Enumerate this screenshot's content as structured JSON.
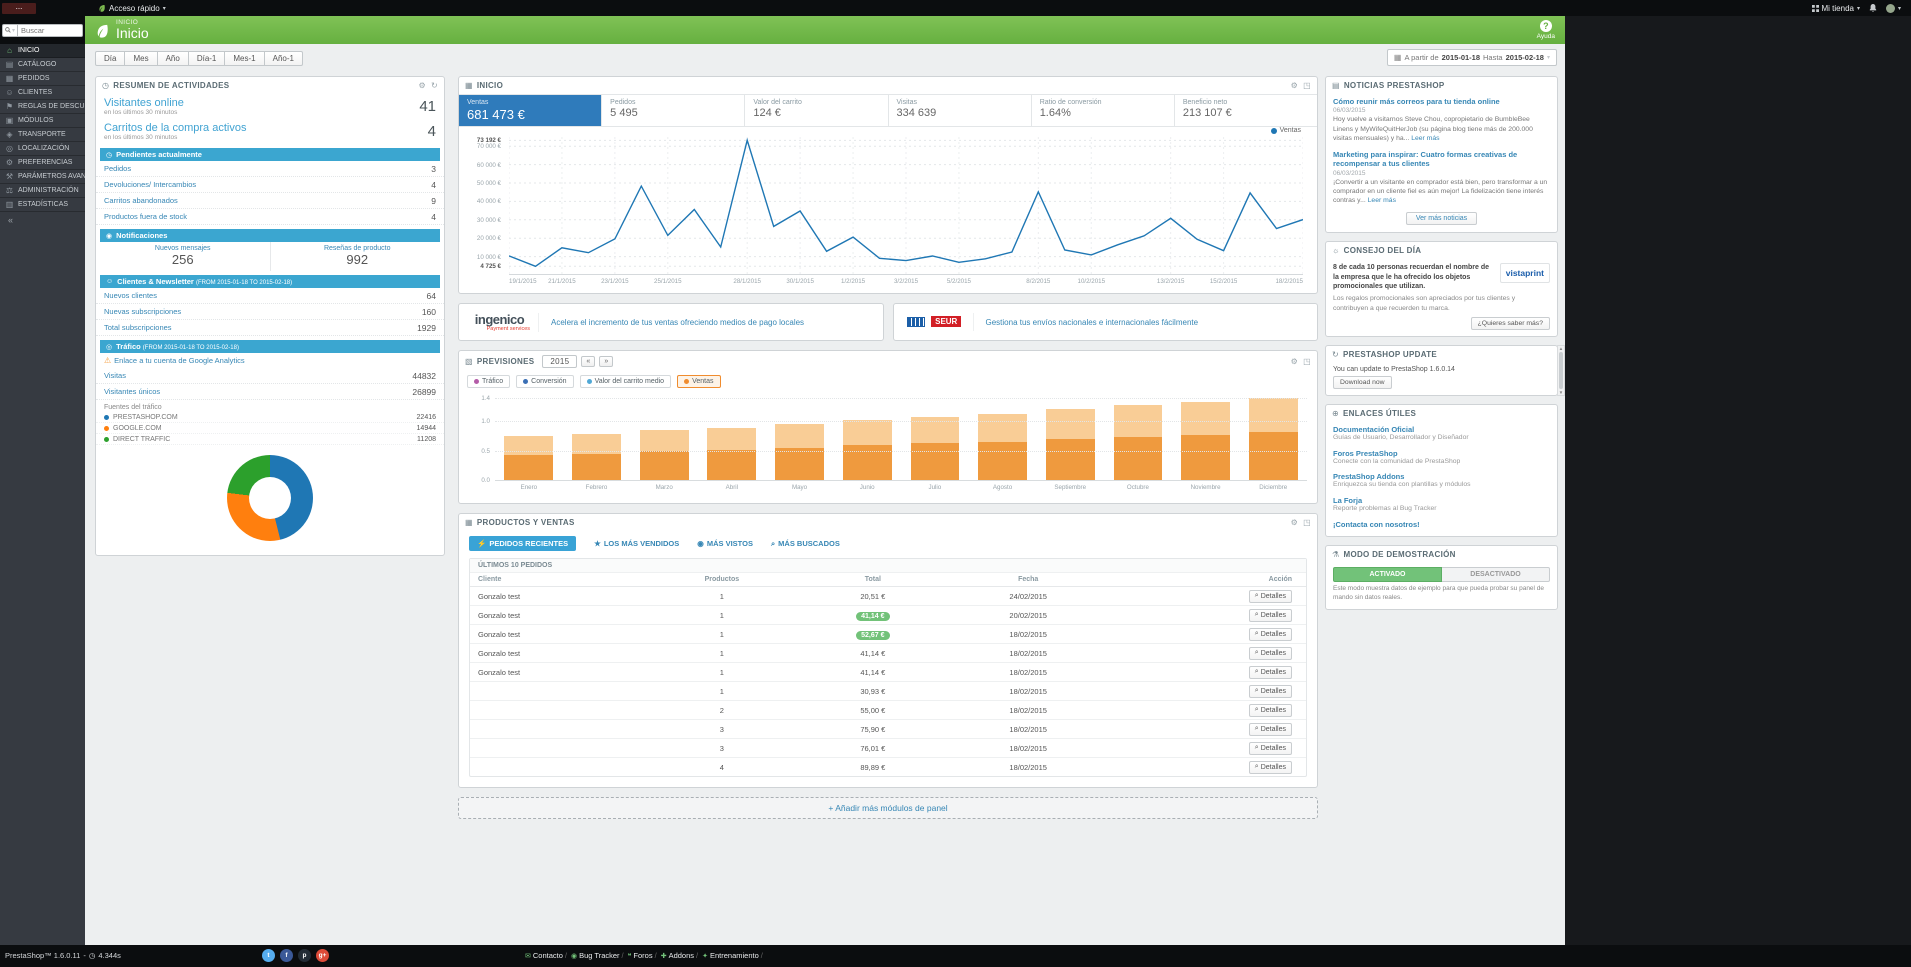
{
  "icons": {
    "gear": "⚙",
    "refresh": "↻",
    "expand": "◳",
    "caret_down": "▾",
    "clock": "◷",
    "calendar": "▦",
    "warning": "⚠",
    "bulb": "☼",
    "news": "▤",
    "panel": "▦",
    "forecast": "▧",
    "link": "⊕",
    "flask": "⚗",
    "plus": "+",
    "help": "?",
    "prev": "«",
    "next": "»",
    "collapse": "«",
    "time": "◷",
    "up": "▲",
    "down": "▼"
  },
  "topbar": {
    "logo_text": "...",
    "quick_access": "Acceso rápido",
    "shop_name": "Mi tienda",
    "search_placeholder": "Buscar"
  },
  "header": {
    "breadcrumb": "INICIO",
    "title": "Inicio",
    "help_label": "Ayuda"
  },
  "sidebar": {
    "items": [
      {
        "icon": "⌂",
        "label": "INICIO",
        "active": true
      },
      {
        "icon": "▤",
        "label": "CATÁLOGO"
      },
      {
        "icon": "▦",
        "label": "PEDIDOS"
      },
      {
        "icon": "☺",
        "label": "CLIENTES"
      },
      {
        "icon": "⚑",
        "label": "REGLAS DE DESCUENTOS"
      },
      {
        "icon": "▣",
        "label": "MÓDULOS"
      },
      {
        "icon": "◈",
        "label": "TRANSPORTE"
      },
      {
        "icon": "◎",
        "label": "LOCALIZACIÓN"
      },
      {
        "icon": "⚙",
        "label": "PREFERENCIAS"
      },
      {
        "icon": "⚒",
        "label": "PARÁMETROS AVANZADOS"
      },
      {
        "icon": "⚖",
        "label": "ADMINISTRACIÓN"
      },
      {
        "icon": "▥",
        "label": "ESTADÍSTICAS"
      }
    ]
  },
  "toolbar": {
    "range_buttons": [
      "Día",
      "Mes",
      "Año",
      "Día-1",
      "Mes-1",
      "Año-1"
    ],
    "from_label": "A partir de",
    "from_date": "2015-01-18",
    "to_label": "Hasta",
    "to_date": "2015-02-18"
  },
  "activity": {
    "title": "RESUMEN DE ACTIVIDADES",
    "online": {
      "label": "Visitantes online",
      "sub": "en los últimos 30 minutos",
      "value": "41"
    },
    "carts": {
      "label": "Carritos de la compra activos",
      "sub": "en los últimos 30 minutos",
      "value": "4"
    },
    "pending_title": "Pendientes actualmente",
    "pending_icon": "◷",
    "pending": [
      {
        "label": "Pedidos",
        "value": "3"
      },
      {
        "label": "Devoluciones/ Intercambios",
        "value": "4"
      },
      {
        "label": "Carritos abandonados",
        "value": "9"
      },
      {
        "label": "Productos fuera de stock",
        "value": "4"
      }
    ],
    "notifications_title": "Notificaciones",
    "notifications_icon": "◉",
    "notifications": [
      {
        "label": "Nuevos mensajes",
        "value": "256"
      },
      {
        "label": "Reseñas de producto",
        "value": "992"
      }
    ],
    "customers_title": "Clientes & Newsletter",
    "customers_icon": "☺",
    "customers_range": "(FROM 2015-01-18 TO 2015-02-18)",
    "customers": [
      {
        "label": "Nuevos clientes",
        "value": "64"
      },
      {
        "label": "Nuevas subscripciones",
        "value": "160"
      },
      {
        "label": "Total subscripciones",
        "value": "1929"
      }
    ],
    "traffic_title": "Tráfico",
    "traffic_icon": "◎",
    "traffic_range": "(FROM 2015-01-18 TO 2015-02-18)",
    "analytics_link": "Enlace a tu cuenta de Google Analytics",
    "traffic_rows": [
      {
        "label": "Visitas",
        "value": "44832"
      },
      {
        "label": "Visitantes únicos",
        "value": "26899"
      }
    ],
    "sources_label": "Fuentes del tráfico",
    "sources": [
      {
        "label": "PRESTASHOP.COM",
        "value": "22416",
        "color": "#1f77b4"
      },
      {
        "label": "GOOGLE.COM",
        "value": "14944",
        "color": "#ff7f0e"
      },
      {
        "label": "DIRECT TRAFFIC",
        "value": "11208",
        "color": "#2ca02c"
      }
    ]
  },
  "trends": {
    "title": "INICIO",
    "kpis": [
      {
        "label": "Ventas",
        "value": "681 473 €",
        "active": true
      },
      {
        "label": "Pedidos",
        "value": "5 495"
      },
      {
        "label": "Valor del carrito",
        "value": "124 €"
      },
      {
        "label": "Visitas",
        "value": "334 639"
      },
      {
        "label": "Ratio de conversión",
        "value": "1.64%"
      },
      {
        "label": "Beneficio neto",
        "value": "213 107 €"
      }
    ],
    "legend": "Ventas"
  },
  "banners": [
    {
      "brand": "ingenico",
      "brand_sub": "Payment services",
      "text": "Acelera el incremento de tus ventas ofreciendo medios de pago locales"
    },
    {
      "brand": "SEUR",
      "text": "Gestiona tus envíos nacionales e internacionales fácilmente"
    }
  ],
  "forecast_panel": {
    "title": "PREVISIONES",
    "year": "2015",
    "metrics": [
      {
        "label": "Tráfico",
        "color": "#B45CA8"
      },
      {
        "label": "Conversión",
        "color": "#3B6FB5"
      },
      {
        "label": "Valor del carrito medio",
        "color": "#50A8D6"
      },
      {
        "label": "Ventas",
        "color": "#F08C2E",
        "active": true
      }
    ]
  },
  "products": {
    "title": "PRODUCTOS Y VENTAS",
    "tabs": [
      {
        "icon": "⚡",
        "label": "PEDIDOS RECIENTES",
        "active": true
      },
      {
        "icon": "★",
        "label": "LOS MÁS VENDIDOS"
      },
      {
        "icon": "◉",
        "label": "MÁS VISTOS"
      },
      {
        "icon": "⌕",
        "label": "MÁS BUSCADOS"
      }
    ],
    "subtitle": "ÚLTIMOS 10 PEDIDOS",
    "headers": [
      "Cliente",
      "Productos",
      "Total",
      "Fecha",
      "Acción"
    ],
    "action_icon": "⌕",
    "action_label": "Detalles",
    "rows": [
      {
        "client": "Gonzalo test",
        "products": "1",
        "total": "20,51 €",
        "badge": false,
        "date": "24/02/2015"
      },
      {
        "client": "Gonzalo test",
        "products": "1",
        "total": "41,14 €",
        "badge": true,
        "date": "20/02/2015"
      },
      {
        "client": "Gonzalo test",
        "products": "1",
        "total": "52,67 €",
        "badge": true,
        "date": "18/02/2015"
      },
      {
        "client": "Gonzalo test",
        "products": "1",
        "total": "41,14 €",
        "badge": false,
        "date": "18/02/2015"
      },
      {
        "client": "Gonzalo test",
        "products": "1",
        "total": "41,14 €",
        "badge": false,
        "date": "18/02/2015"
      },
      {
        "client": "",
        "products": "1",
        "total": "30,93 €",
        "badge": false,
        "date": "18/02/2015"
      },
      {
        "client": "",
        "products": "2",
        "total": "55,00 €",
        "badge": false,
        "date": "18/02/2015"
      },
      {
        "client": "",
        "products": "3",
        "total": "75,90 €",
        "badge": false,
        "date": "18/02/2015"
      },
      {
        "client": "",
        "products": "3",
        "total": "76,01 €",
        "badge": false,
        "date": "18/02/2015"
      },
      {
        "client": "",
        "products": "4",
        "total": "89,89 €",
        "badge": false,
        "date": "18/02/2015"
      }
    ]
  },
  "add_module_label": "Añadir más módulos de panel",
  "news": {
    "title": "NOTICIAS PRESTASHOP",
    "items": [
      {
        "headline": "Cómo reunir más correos para tu tienda online",
        "date": "06/03/2015",
        "body": "Hoy vuelve a visitarnos Steve Chou, copropietario de BumbleBee Linens y MyWifeQuitHerJob (su página blog tiene más de 200.000 visitas mensuales) y ha...",
        "more": "Leer más"
      },
      {
        "headline": "Marketing para inspirar: Cuatro formas creativas de recompensar a tus clientes",
        "date": "06/03/2015",
        "body": "¡Convertir a un visitante en comprador está bien, pero transformar a un comprador en un cliente fiel es aún mejor! La fidelización tiene interés contras y...",
        "more": "Leer más"
      }
    ],
    "more_button": "Ver más noticias"
  },
  "tip": {
    "title": "CONSEJO DEL DÍA",
    "highlight": "8 de cada 10 personas recuerdan el nombre de la empresa que le ha ofrecido los objetos promocionales que utilizan.",
    "body": "Los regalos promocionales son apreciados por tus clientes y contribuyen a que recuerden tu marca.",
    "brand": "vistaprint",
    "button": "¿Quieres saber más?"
  },
  "update": {
    "title": "PRESTASHOP UPDATE",
    "text": "You can update to PrestaShop 1.6.0.14",
    "button": "Download now"
  },
  "links": {
    "title": "ENLACES ÚTILES",
    "items": [
      {
        "label": "Documentación Oficial",
        "desc": "Guías de Usuario, Desarrollador y Diseñador"
      },
      {
        "label": "Foros PrestaShop",
        "desc": "Conecte con la comunidad de PrestaShop"
      },
      {
        "label": "PrestaShop Addons",
        "desc": "Enriquezca su tienda con plantillas y módulos"
      },
      {
        "label": "La Forja",
        "desc": "Reporte problemas al Bug Tracker"
      },
      {
        "label": "¡Contacta con nosotros!",
        "desc": ""
      }
    ]
  },
  "demo": {
    "title": "MODO DE DEMOSTRACIÓN",
    "on_label": "ACTIVADO",
    "off_label": "DESACTIVADO",
    "text": "Este modo muestra datos de ejemplo para que pueda probar su panel de mando sin datos reales."
  },
  "footer": {
    "version": "PrestaShop™ 1.6.0.11",
    "sep": "-",
    "load_time": "4.344s",
    "socials": [
      {
        "name": "twitter",
        "label": "t",
        "color": "#55ACEE"
      },
      {
        "name": "facebook",
        "label": "f",
        "color": "#3B5998"
      },
      {
        "name": "prestashop",
        "label": "p",
        "color": "#232C36"
      },
      {
        "name": "googleplus",
        "label": "g+",
        "color": "#DD4B39"
      }
    ],
    "links": [
      {
        "icon": "✉",
        "label": "Contacto"
      },
      {
        "icon": "◉",
        "label": "Bug Tracker"
      },
      {
        "icon": "❝",
        "label": "Foros"
      },
      {
        "icon": "✚",
        "label": "Addons"
      },
      {
        "icon": "✦",
        "label": "Entrenamiento"
      }
    ]
  },
  "chart_data": [
    {
      "id": "sales_trend",
      "type": "line",
      "title": "Ventas",
      "color": "#1f77b4",
      "ylim": [
        0,
        75000
      ],
      "x": [
        "19/1/2015",
        "20/1/2015",
        "21/1/2015",
        "22/1/2015",
        "23/1/2015",
        "24/1/2015",
        "25/1/2015",
        "26/1/2015",
        "27/1/2015",
        "28/1/2015",
        "29/1/2015",
        "30/1/2015",
        "31/1/2015",
        "1/2/2015",
        "2/2/2015",
        "3/2/2015",
        "4/2/2015",
        "5/2/2015",
        "6/2/2015",
        "7/2/2015",
        "8/2/2015",
        "9/2/2015",
        "10/2/2015",
        "11/2/2015",
        "12/2/2015",
        "13/2/2015",
        "14/2/2015",
        "15/2/2015",
        "16/2/2015",
        "17/2/2015",
        "18/2/2015"
      ],
      "values": [
        10400,
        4725,
        14800,
        12100,
        19600,
        48300,
        21500,
        35600,
        15200,
        73192,
        26400,
        34800,
        12900,
        20600,
        9100,
        7800,
        10300,
        6900,
        8800,
        12500,
        45200,
        13600,
        10900,
        16400,
        21300,
        30800,
        19400,
        13200,
        44600,
        25200,
        30100
      ],
      "y_ticks": [
        {
          "label": "73 192 €",
          "value": 73192,
          "strong": true
        },
        {
          "label": "70 000 €",
          "value": 70000
        },
        {
          "label": "60 000 €",
          "value": 60000
        },
        {
          "label": "50 000 €",
          "value": 50000
        },
        {
          "label": "40 000 €",
          "value": 40000
        },
        {
          "label": "30 000 €",
          "value": 30000
        },
        {
          "label": "20 000 €",
          "value": 20000
        },
        {
          "label": "10 000 €",
          "value": 10000
        },
        {
          "label": "4 725 €",
          "value": 4725,
          "strong": true
        }
      ],
      "x_ticks": [
        {
          "label": "19/1/2015",
          "index": 0
        },
        {
          "label": "21/1/2015",
          "index": 2
        },
        {
          "label": "23/1/2015",
          "index": 4
        },
        {
          "label": "25/1/2015",
          "index": 6
        },
        {
          "label": "28/1/2015",
          "index": 9
        },
        {
          "label": "30/1/2015",
          "index": 11
        },
        {
          "label": "1/2/2015",
          "index": 13
        },
        {
          "label": "3/2/2015",
          "index": 15
        },
        {
          "label": "5/2/2015",
          "index": 17
        },
        {
          "label": "8/2/2015",
          "index": 20
        },
        {
          "label": "10/2/2015",
          "index": 22
        },
        {
          "label": "13/2/2015",
          "index": 25
        },
        {
          "label": "15/2/2015",
          "index": 27
        },
        {
          "label": "18/2/2015",
          "index": 30
        }
      ],
      "legend": [
        "Ventas"
      ]
    },
    {
      "id": "forecast",
      "type": "bar",
      "title": "PREVISIONES",
      "categories": [
        "Enero",
        "Febrero",
        "Marzo",
        "Abril",
        "Mayo",
        "Junio",
        "Julio",
        "Agosto",
        "Septiembre",
        "Octubre",
        "Noviembre",
        "Diciembre"
      ],
      "values": [
        0.75,
        0.78,
        0.85,
        0.88,
        0.95,
        1.02,
        1.08,
        1.12,
        1.22,
        1.28,
        1.33,
        1.4
      ],
      "split": 0.58,
      "color_bottom": "#EF9A3E",
      "color_top": "#F9CD96",
      "ylim": [
        0,
        1.45
      ],
      "y_ticks": [
        {
          "label": "0.0",
          "value": 0
        },
        {
          "label": "0.5",
          "value": 0.5
        },
        {
          "label": "1.0",
          "value": 1.0
        },
        {
          "label": "1.4",
          "value": 1.4
        }
      ]
    },
    {
      "id": "traffic_sources",
      "type": "pie",
      "title": "Fuentes del tráfico",
      "labels": [
        "PRESTASHOP.COM",
        "GOOGLE.COM",
        "DIRECT TRAFFIC"
      ],
      "values": [
        22416,
        14944,
        11208
      ],
      "colors": [
        "#1f77b4",
        "#ff7f0e",
        "#2ca02c"
      ],
      "inner_radius": 0.55
    }
  ]
}
